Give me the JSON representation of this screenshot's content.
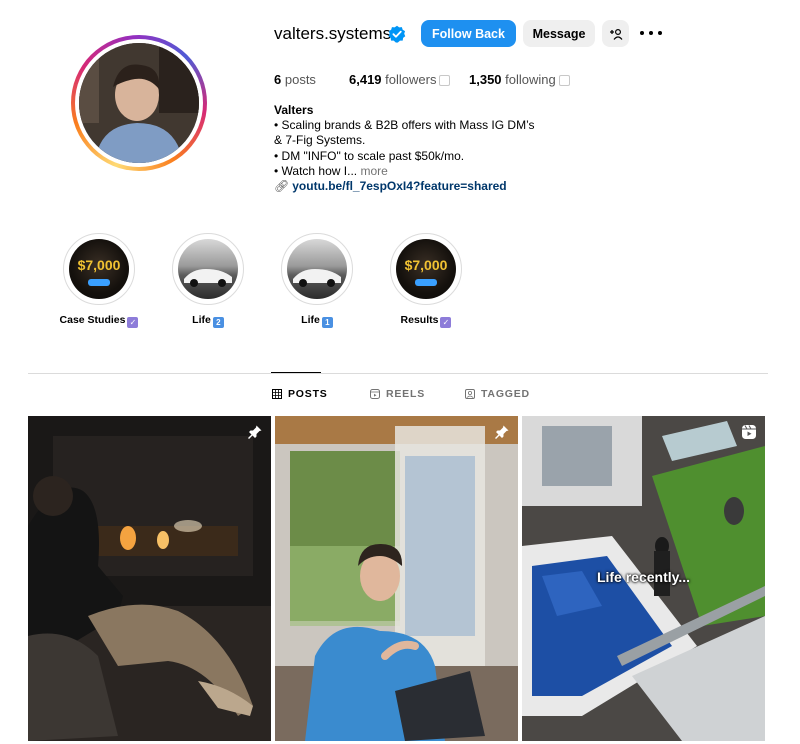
{
  "profile": {
    "username": "valters.systems",
    "buttons": {
      "follow_back": "Follow Back",
      "message": "Message",
      "add_user_icon": "+ō"
    },
    "stats": {
      "posts_count": "6",
      "posts_label": "posts",
      "followers_count": "6,419",
      "followers_label": "followers",
      "following_count": "1,350",
      "following_label": "following"
    },
    "bio": {
      "name": "Valters",
      "line1": "• Scaling brands & B2B offers with Mass IG DM’s",
      "line2": "& 7-Fig Systems.",
      "line3": "• DM \"INFO\" to scale past $50k/mo.",
      "line4": "• Watch how I...",
      "more": "more",
      "link": "youtu.be/fl_7espOxI4?feature=shared"
    }
  },
  "highlights": [
    {
      "label": "Case Studies",
      "badge": "✓",
      "money": "$7,000"
    },
    {
      "label": "Life",
      "badge": "2"
    },
    {
      "label": "Life",
      "badge": "1"
    },
    {
      "label": "Results",
      "badge": "✓",
      "money": "$7,000"
    }
  ],
  "tabs": {
    "posts": "POSTS",
    "reels": "REELS",
    "tagged": "TAGGED"
  },
  "posts": {
    "reel_overlay_text": "Life recently..."
  },
  "colors": {
    "primary_button": "#1e90f0",
    "link": "#00376b",
    "verified": "#0095f6"
  },
  "icons": {
    "verified": "verified-badge-icon",
    "more": "more-horizontal-icon",
    "pin": "pin-icon",
    "reel": "reel-icon",
    "link": "link-icon"
  }
}
